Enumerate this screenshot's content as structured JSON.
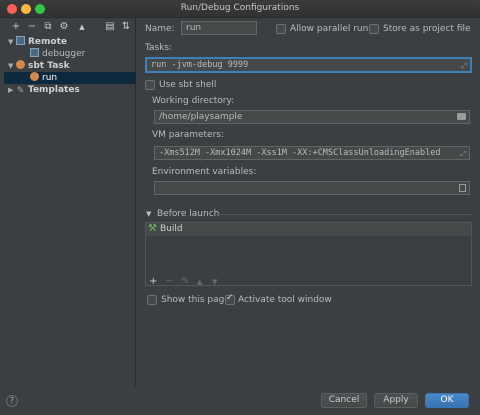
{
  "window": {
    "title": "Run/Debug Configurations"
  },
  "toolbar": {
    "add": "+",
    "remove": "−",
    "copy": "⧉",
    "edit": "⚙",
    "up": "▲",
    "folder": "▤",
    "sort": "⇅"
  },
  "tree": {
    "remote": {
      "label": "Remote",
      "child": "debugger"
    },
    "sbt_task": {
      "label": "sbt Task",
      "child": "run"
    },
    "templates": {
      "label": "Templates"
    }
  },
  "form": {
    "name_label": "Name:",
    "name_value": "run",
    "allow_parallel_label": "Allow parallel run",
    "store_project_label": "Store as project file",
    "tasks_label": "Tasks:",
    "tasks_value": "run -jvm-debug 9999",
    "use_sbt_shell_label": "Use sbt shell",
    "working_dir_label": "Working directory:",
    "working_dir_value": "/home/playsample",
    "vm_params_label": "VM parameters:",
    "vm_params_value": "-Xms512M -Xmx1024M -Xss1M -XX:+CMSClassUnloadingEnabled",
    "env_vars_label": "Environment variables:",
    "env_vars_value": ""
  },
  "before_launch": {
    "header": "Before launch",
    "items": [
      "Build"
    ],
    "tools": {
      "add": "+",
      "remove": "−",
      "edit": "✎",
      "up": "▲",
      "down": "▼"
    }
  },
  "options": {
    "show_page_label": "Show this page",
    "activate_tool_label": "Activate tool window"
  },
  "buttons": {
    "cancel": "Cancel",
    "apply": "Apply",
    "ok": "OK"
  },
  "colors": {
    "accent": "#3d7ebd",
    "selection": "#0d293e",
    "ok_button": "#4a88c7"
  }
}
